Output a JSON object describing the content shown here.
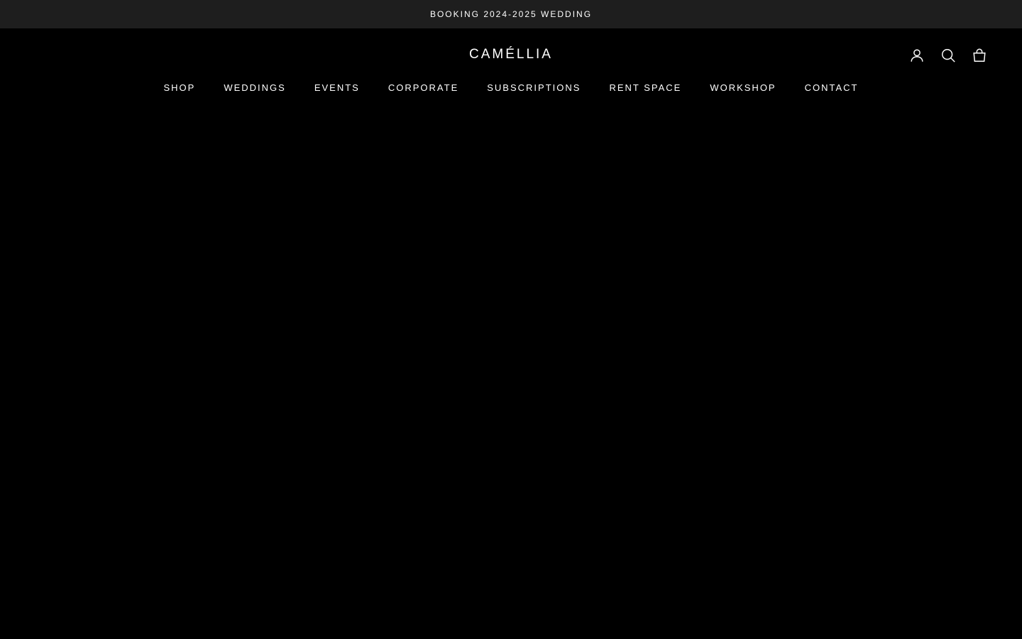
{
  "announcement": {
    "text": "BOOKING 2024-2025 WEDDING"
  },
  "header": {
    "logo": "CAMÉLLIA",
    "icons": [
      "account-icon",
      "search-icon",
      "cart-icon"
    ]
  },
  "nav": {
    "items": [
      {
        "label": "SHOP"
      },
      {
        "label": "WEDDINGS"
      },
      {
        "label": "EVENTS"
      },
      {
        "label": "CORPORATE"
      },
      {
        "label": "SUBSCRIPTIONS"
      },
      {
        "label": "RENT SPACE"
      },
      {
        "label": "WORKSHOP"
      },
      {
        "label": "CONTACT"
      }
    ]
  },
  "colors": {
    "background": "#000000",
    "announcement_bar": "#1e1e1e",
    "text": "#ffffff"
  }
}
